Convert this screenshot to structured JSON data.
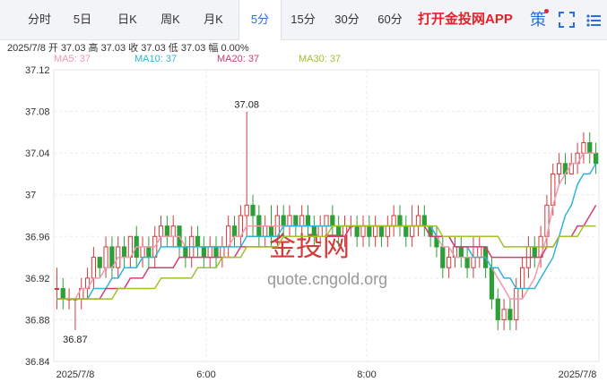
{
  "tabs": [
    {
      "label": "分时",
      "active": false
    },
    {
      "label": "5日",
      "active": false
    },
    {
      "label": "日K",
      "active": false
    },
    {
      "label": "周K",
      "active": false
    },
    {
      "label": "月K",
      "active": false
    },
    {
      "label": "5分",
      "active": true
    },
    {
      "label": "15分",
      "active": false
    },
    {
      "label": "30分",
      "active": false
    },
    {
      "label": "60分",
      "active": false
    }
  ],
  "app_link": "打开金投网APP",
  "icons": [
    "strategy-icon",
    "fullscreen-icon",
    "menu-icon"
  ],
  "strategy_label": "策",
  "quote_line": "2025/7/8  开 37.03  高 37.03  收 37.03  低 37.03  幅 0.00%",
  "ma_legend": [
    {
      "label": "MA5: 37",
      "color": "#f497b0"
    },
    {
      "label": "MA10: 37",
      "color": "#2fb4d8"
    },
    {
      "label": "MA20: 37",
      "color": "#d93b6e"
    },
    {
      "label": "MA30: 37",
      "color": "#9fc12a"
    }
  ],
  "watermark": {
    "brand": "金投网",
    "url": "quote.cngold.org"
  },
  "colors": {
    "up": "#d33b3b",
    "down": "#2e9e38",
    "accent": "#2a6fdb",
    "app_link": "#e6212a"
  },
  "chart_data": {
    "type": "candlestick",
    "title": "",
    "x_ticks": [
      "2025/7/8",
      "6:00",
      "8:00",
      "2025/7/8"
    ],
    "y_ticks": [
      "37.12",
      "37.08",
      "37.04",
      "37",
      "36.96",
      "36.92",
      "36.88",
      "36.84"
    ],
    "ylim": [
      36.84,
      37.12
    ],
    "annotations": [
      "37.08",
      "36.87"
    ],
    "candles": [
      [
        36.91,
        36.91,
        36.93,
        36.89
      ],
      [
        36.91,
        36.9,
        36.92,
        36.89
      ],
      [
        36.9,
        36.9,
        36.91,
        36.89
      ],
      [
        36.9,
        36.9,
        36.9,
        36.87
      ],
      [
        36.9,
        36.91,
        36.92,
        36.89
      ],
      [
        36.91,
        36.92,
        36.93,
        36.9
      ],
      [
        36.92,
        36.94,
        36.95,
        36.91
      ],
      [
        36.94,
        36.93,
        36.94,
        36.92
      ],
      [
        36.93,
        36.95,
        36.96,
        36.92
      ],
      [
        36.95,
        36.93,
        36.96,
        36.92
      ],
      [
        36.93,
        36.95,
        36.96,
        36.92
      ],
      [
        36.95,
        36.94,
        36.96,
        36.93
      ],
      [
        36.94,
        36.96,
        36.96,
        36.93
      ],
      [
        36.96,
        36.94,
        36.97,
        36.93
      ],
      [
        36.94,
        36.95,
        36.96,
        36.93
      ],
      [
        36.95,
        36.94,
        36.96,
        36.93
      ],
      [
        36.94,
        36.96,
        36.97,
        36.93
      ],
      [
        36.96,
        36.97,
        36.98,
        36.95
      ],
      [
        36.97,
        36.96,
        36.98,
        36.95
      ],
      [
        36.96,
        36.97,
        36.98,
        36.95
      ],
      [
        36.97,
        36.95,
        36.97,
        36.94
      ],
      [
        36.95,
        36.94,
        36.96,
        36.93
      ],
      [
        36.94,
        36.96,
        36.97,
        36.93
      ],
      [
        36.96,
        36.95,
        36.97,
        36.94
      ],
      [
        36.95,
        36.94,
        36.96,
        36.93
      ],
      [
        36.94,
        36.95,
        36.96,
        36.93
      ],
      [
        36.95,
        36.94,
        36.96,
        36.93
      ],
      [
        36.94,
        36.95,
        36.96,
        36.93
      ],
      [
        36.95,
        36.97,
        36.98,
        36.94
      ],
      [
        36.97,
        36.96,
        36.98,
        36.95
      ],
      [
        36.96,
        36.98,
        36.99,
        36.95
      ],
      [
        36.98,
        36.99,
        37.08,
        36.96
      ],
      [
        36.99,
        36.98,
        37.0,
        36.96
      ],
      [
        36.98,
        36.96,
        36.99,
        36.95
      ],
      [
        36.96,
        36.97,
        36.98,
        36.95
      ],
      [
        36.97,
        36.96,
        36.99,
        36.95
      ],
      [
        36.96,
        36.98,
        36.99,
        36.95
      ],
      [
        36.98,
        36.97,
        36.99,
        36.96
      ],
      [
        36.97,
        36.98,
        36.99,
        36.96
      ],
      [
        36.98,
        36.97,
        36.98,
        36.96
      ],
      [
        36.97,
        36.98,
        36.99,
        36.96
      ],
      [
        36.98,
        36.97,
        36.99,
        36.96
      ],
      [
        36.97,
        36.96,
        36.98,
        36.95
      ],
      [
        36.96,
        36.97,
        36.98,
        36.95
      ],
      [
        36.97,
        36.98,
        36.98,
        36.96
      ],
      [
        36.98,
        36.97,
        36.99,
        36.96
      ],
      [
        36.97,
        36.96,
        36.98,
        36.95
      ],
      [
        36.96,
        36.97,
        36.98,
        36.95
      ],
      [
        36.97,
        36.97,
        36.98,
        36.96
      ],
      [
        36.97,
        36.96,
        36.98,
        36.95
      ],
      [
        36.96,
        36.97,
        36.98,
        36.95
      ],
      [
        36.97,
        36.96,
        36.98,
        36.95
      ],
      [
        36.96,
        36.97,
        36.98,
        36.95
      ],
      [
        36.97,
        36.96,
        36.97,
        36.95
      ],
      [
        36.96,
        36.97,
        36.98,
        36.95
      ],
      [
        36.97,
        36.98,
        36.99,
        36.96
      ],
      [
        36.98,
        36.97,
        36.99,
        36.96
      ],
      [
        36.97,
        36.96,
        36.98,
        36.95
      ],
      [
        36.96,
        36.97,
        36.99,
        36.95
      ],
      [
        36.97,
        36.98,
        36.99,
        36.96
      ],
      [
        36.98,
        36.97,
        36.99,
        36.96
      ],
      [
        36.97,
        36.96,
        36.97,
        36.95
      ],
      [
        36.96,
        36.95,
        36.97,
        36.94
      ],
      [
        36.95,
        36.93,
        36.96,
        36.92
      ],
      [
        36.93,
        36.94,
        36.95,
        36.92
      ],
      [
        36.94,
        36.95,
        36.96,
        36.93
      ],
      [
        36.95,
        36.94,
        36.96,
        36.93
      ],
      [
        36.94,
        36.93,
        36.95,
        36.92
      ],
      [
        36.93,
        36.94,
        36.96,
        36.92
      ],
      [
        36.94,
        36.95,
        36.96,
        36.93
      ],
      [
        36.95,
        36.93,
        36.95,
        36.92
      ],
      [
        36.93,
        36.9,
        36.94,
        36.89
      ],
      [
        36.9,
        36.88,
        36.91,
        36.87
      ],
      [
        36.88,
        36.89,
        36.9,
        36.87
      ],
      [
        36.89,
        36.88,
        36.9,
        36.87
      ],
      [
        36.88,
        36.91,
        36.92,
        36.87
      ],
      [
        36.91,
        36.93,
        36.94,
        36.9
      ],
      [
        36.93,
        36.95,
        36.96,
        36.92
      ],
      [
        36.95,
        36.94,
        36.96,
        36.93
      ],
      [
        36.94,
        36.96,
        36.97,
        36.93
      ],
      [
        36.96,
        36.99,
        37.0,
        36.95
      ],
      [
        36.99,
        37.02,
        37.03,
        36.98
      ],
      [
        37.02,
        37.03,
        37.04,
        37.01
      ],
      [
        37.03,
        37.02,
        37.04,
        37.01
      ],
      [
        37.02,
        37.03,
        37.04,
        37.02
      ],
      [
        37.03,
        37.04,
        37.05,
        37.02
      ],
      [
        37.04,
        37.05,
        37.06,
        37.03
      ],
      [
        37.05,
        37.04,
        37.06,
        37.03
      ],
      [
        37.04,
        37.03,
        37.05,
        37.02
      ]
    ],
    "series": [
      {
        "name": "MA5",
        "color": "#f497b0",
        "values": [
          36.9,
          36.9,
          36.9,
          36.9,
          36.91,
          36.91,
          36.92,
          36.92,
          36.93,
          36.93,
          36.94,
          36.94,
          36.94,
          36.95,
          36.95,
          36.95,
          36.95,
          36.96,
          36.96,
          36.96,
          36.96,
          36.95,
          36.95,
          36.95,
          36.95,
          36.95,
          36.95,
          36.95,
          36.95,
          36.96,
          36.96,
          36.97,
          36.97,
          36.97,
          36.97,
          36.97,
          36.97,
          36.97,
          36.97,
          36.97,
          36.97,
          36.97,
          36.97,
          36.97,
          36.97,
          36.97,
          36.97,
          36.97,
          36.97,
          36.97,
          36.97,
          36.97,
          36.97,
          36.97,
          36.97,
          36.97,
          36.97,
          36.97,
          36.97,
          36.97,
          36.97,
          36.97,
          36.96,
          36.95,
          36.95,
          36.94,
          36.94,
          36.94,
          36.94,
          36.94,
          36.94,
          36.93,
          36.92,
          36.91,
          36.9,
          36.9,
          36.9,
          36.91,
          36.92,
          36.94,
          36.96,
          36.99,
          37.01,
          37.02,
          37.03,
          37.03,
          37.04,
          37.04,
          37.04
        ]
      },
      {
        "name": "MA10",
        "color": "#2fb4d8",
        "values": [
          36.9,
          36.9,
          36.9,
          36.9,
          36.9,
          36.9,
          36.91,
          36.91,
          36.91,
          36.92,
          36.92,
          36.93,
          36.93,
          36.93,
          36.94,
          36.94,
          36.94,
          36.95,
          36.95,
          36.95,
          36.95,
          36.95,
          36.95,
          36.95,
          36.95,
          36.95,
          36.95,
          36.95,
          36.95,
          36.95,
          36.95,
          36.96,
          36.96,
          36.96,
          36.96,
          36.96,
          36.96,
          36.97,
          36.97,
          36.97,
          36.97,
          36.97,
          36.97,
          36.97,
          36.97,
          36.97,
          36.97,
          36.97,
          36.97,
          36.97,
          36.97,
          36.97,
          36.97,
          36.97,
          36.97,
          36.97,
          36.97,
          36.97,
          36.97,
          36.97,
          36.97,
          36.97,
          36.96,
          36.96,
          36.96,
          36.95,
          36.95,
          36.95,
          36.94,
          36.94,
          36.94,
          36.93,
          36.93,
          36.92,
          36.92,
          36.91,
          36.91,
          36.91,
          36.91,
          36.92,
          36.93,
          36.94,
          36.96,
          36.98,
          36.99,
          37.01,
          37.02,
          37.02,
          37.03
        ]
      },
      {
        "name": "MA20",
        "color": "#d93b6e",
        "values": [
          36.9,
          36.9,
          36.9,
          36.9,
          36.9,
          36.9,
          36.9,
          36.9,
          36.91,
          36.91,
          36.91,
          36.91,
          36.92,
          36.92,
          36.92,
          36.93,
          36.93,
          36.93,
          36.93,
          36.93,
          36.94,
          36.94,
          36.94,
          36.94,
          36.94,
          36.94,
          36.94,
          36.94,
          36.94,
          36.94,
          36.95,
          36.95,
          36.95,
          36.95,
          36.95,
          36.95,
          36.95,
          36.96,
          36.96,
          36.96,
          36.96,
          36.96,
          36.96,
          36.96,
          36.96,
          36.96,
          36.96,
          36.96,
          36.97,
          36.97,
          36.97,
          36.97,
          36.97,
          36.97,
          36.97,
          36.97,
          36.97,
          36.97,
          36.97,
          36.97,
          36.97,
          36.96,
          36.96,
          36.96,
          36.96,
          36.95,
          36.95,
          36.95,
          36.95,
          36.95,
          36.95,
          36.94,
          36.94,
          36.94,
          36.94,
          36.94,
          36.94,
          36.94,
          36.94,
          36.94,
          36.95,
          36.95,
          36.96,
          36.96,
          36.96,
          36.97,
          36.97,
          36.98,
          36.99
        ]
      },
      {
        "name": "MA30",
        "color": "#9fc12a",
        "values": [
          36.9,
          36.9,
          36.9,
          36.9,
          36.9,
          36.9,
          36.9,
          36.9,
          36.9,
          36.9,
          36.91,
          36.91,
          36.91,
          36.91,
          36.91,
          36.91,
          36.91,
          36.92,
          36.92,
          36.92,
          36.92,
          36.92,
          36.92,
          36.93,
          36.93,
          36.93,
          36.93,
          36.94,
          36.94,
          36.94,
          36.94,
          36.95,
          36.95,
          36.95,
          36.95,
          36.95,
          36.95,
          36.96,
          36.96,
          36.96,
          36.96,
          36.96,
          36.96,
          36.96,
          36.96,
          36.97,
          36.97,
          36.97,
          36.97,
          36.97,
          36.97,
          36.97,
          36.97,
          36.97,
          36.97,
          36.97,
          36.97,
          36.97,
          36.97,
          36.97,
          36.97,
          36.97,
          36.97,
          36.96,
          36.96,
          36.96,
          36.96,
          36.96,
          36.96,
          36.96,
          36.96,
          36.96,
          36.96,
          36.95,
          36.95,
          36.95,
          36.95,
          36.95,
          36.95,
          36.95,
          36.95,
          36.95,
          36.96,
          36.96,
          36.96,
          36.96,
          36.97,
          36.97,
          36.97
        ]
      }
    ]
  }
}
